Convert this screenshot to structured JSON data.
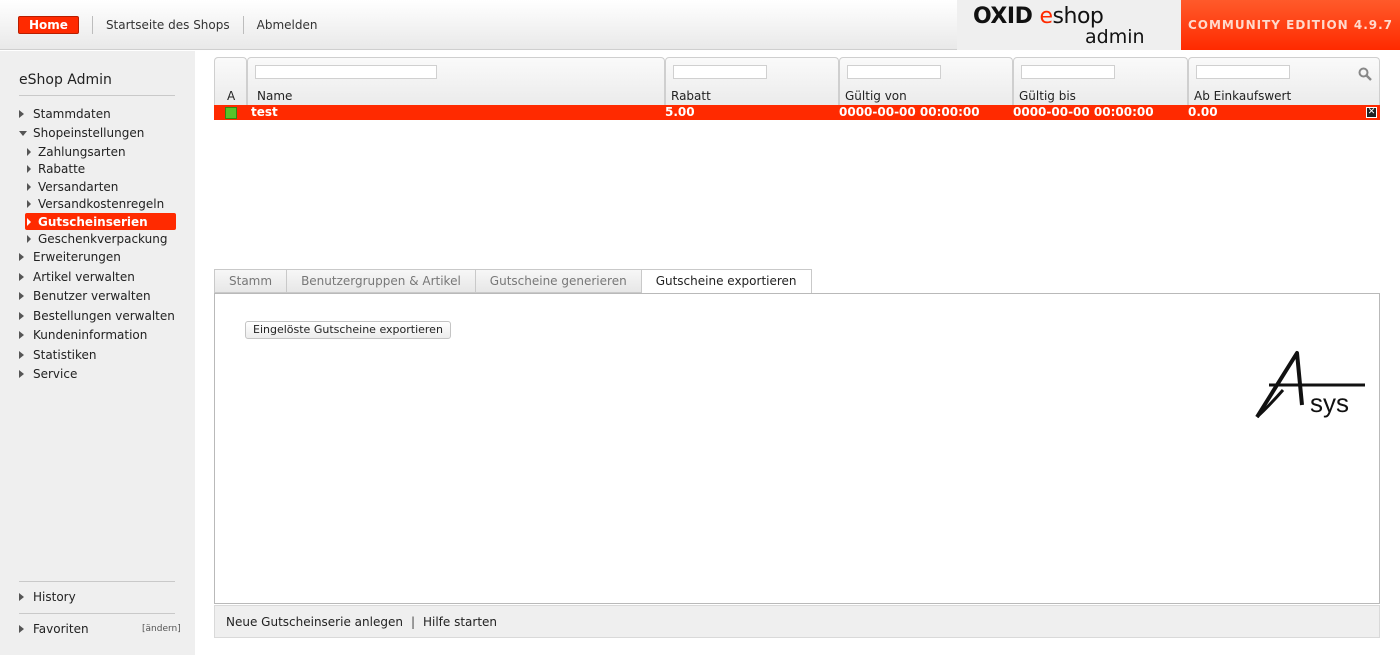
{
  "header": {
    "nav": {
      "home": "Home",
      "shop_start": "Startseite des Shops",
      "logout": "Abmelden"
    },
    "logo": {
      "oxid": "OXID",
      "e": "e",
      "shop": "shop",
      "admin": "admin"
    },
    "edition": "COMMUNITY EDITION 4.9.7"
  },
  "sidebar": {
    "title": "eShop Admin",
    "menu": [
      "Stammdaten",
      "Shopeinstellungen"
    ],
    "sub_items": [
      "Zahlungsarten",
      "Rabatte",
      "Versandarten",
      "Versandkostenregeln",
      "Gutscheinserien",
      "Geschenkverpackung"
    ],
    "active_sub": "Gutscheinserien",
    "more_items": [
      "Erweiterungen",
      "Artikel verwalten",
      "Benutzer verwalten",
      "Bestellungen verwalten",
      "Kundeninformation",
      "Statistiken",
      "Service"
    ],
    "history": "History",
    "favoriten": "Favoriten",
    "aendern": "[ändern]"
  },
  "list": {
    "columns": [
      "A",
      "Name",
      "Rabatt",
      "Gültig von",
      "Gültig bis",
      "Ab Einkaufswert"
    ],
    "rows": [
      {
        "active": true,
        "name": "test",
        "rabatt": "5.00",
        "gueltig_von": "0000-00-00 00:00:00",
        "gueltig_bis": "0000-00-00 00:00:00",
        "ab_einkaufswert": "0.00"
      }
    ],
    "delete_icon": "close-icon",
    "search_icon": "search-icon"
  },
  "tabs": [
    "Stamm",
    "Benutzergruppen & Artikel",
    "Gutscheine generieren",
    "Gutscheine exportieren"
  ],
  "active_tab": "Gutscheine exportieren",
  "panel": {
    "export_button": "Eingelöste Gutscheine exportieren",
    "logo_text": "sys"
  },
  "actionbar": {
    "new_series": "Neue Gutscheinserie anlegen",
    "separator": "|",
    "help": "Hilfe starten"
  },
  "colors": {
    "accent": "#ff2a00",
    "active_green": "#57c32a",
    "sidebar_bg": "#efefef"
  }
}
